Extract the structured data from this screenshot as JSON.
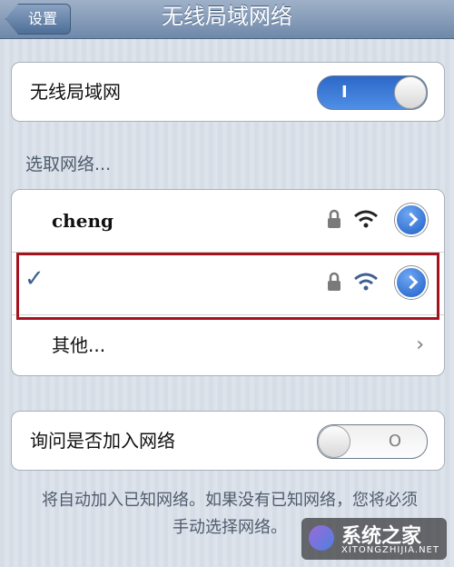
{
  "nav": {
    "back_label": "设置",
    "title": "无线局域网络"
  },
  "wifi_toggle": {
    "label": "无线局域网",
    "state": "on",
    "mark": "I"
  },
  "section_label": "选取网络...",
  "networks": [
    {
      "name": "cheng",
      "locked": true,
      "connected": false
    },
    {
      "name": "",
      "locked": true,
      "connected": true
    },
    {
      "name": "其他...",
      "locked": false,
      "connected": false
    }
  ],
  "ask_toggle": {
    "label": "询问是否加入网络",
    "state": "off",
    "mark": "O"
  },
  "footer_note": "将自动加入已知网络。如果没有已知网络，您将必须手动选择网络。",
  "watermark": {
    "text": "系统之家",
    "sub": "XITONGZHIJIA.NET"
  },
  "colors": {
    "accent": "#2d68c8",
    "highlight": "#a5141e"
  },
  "icons": [
    "lock-icon",
    "wifi-icon",
    "detail-disclosure-icon",
    "checkmark-icon",
    "chevron-right-icon"
  ]
}
